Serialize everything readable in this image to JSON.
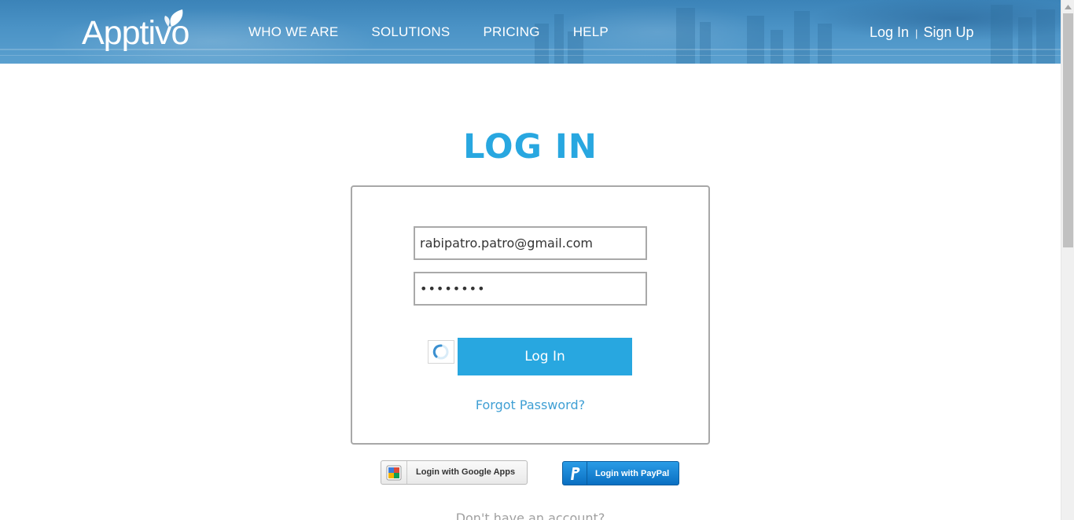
{
  "header": {
    "logo_text": "Apptivo",
    "nav": [
      {
        "label": "WHO WE ARE"
      },
      {
        "label": "SOLUTIONS"
      },
      {
        "label": "PRICING"
      },
      {
        "label": "HELP"
      }
    ],
    "login_link": "Log In",
    "separator": "|",
    "signup_link": "Sign Up"
  },
  "main": {
    "title": "LOG IN",
    "email_value": "rabipatro.patro@gmail.com",
    "password_value": "••••••••",
    "login_button": "Log In",
    "forgot_password": "Forgot Password?",
    "google_button": "Login with Google Apps",
    "paypal_button": "Login with PayPal",
    "signup_prompt": "Don't have an account?"
  },
  "colors": {
    "accent": "#28a7e0",
    "header_blue": "#4b93c6",
    "paypal_blue": "#0a6fc2"
  },
  "icons": [
    "leaf-icon",
    "loading-spinner-icon",
    "google-apps-icon",
    "paypal-icon",
    "scroll-up-arrow-icon"
  ]
}
